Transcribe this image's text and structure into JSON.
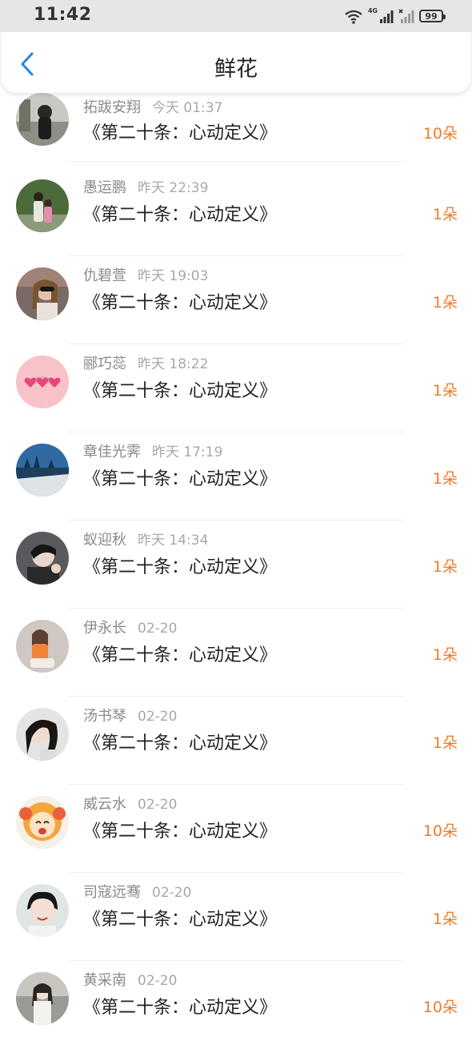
{
  "status_bar": {
    "time": "11:42",
    "battery": "99",
    "network": "4G",
    "icons": [
      "wifi-icon",
      "signal-icon",
      "signal-no-service-icon",
      "battery-icon"
    ]
  },
  "header": {
    "title": "鲜花",
    "back_icon": "chevron-left-icon",
    "accent": "#1e88e5"
  },
  "colors": {
    "count": "#f07b2a",
    "name": "#8a8a8a",
    "title": "#222222"
  },
  "items": [
    {
      "name": "拓跋安翔",
      "time": "今天 01:37",
      "title": "《第二十条：心动定义》",
      "count": "10朵"
    },
    {
      "name": "愚运鹏",
      "time": "昨天 22:39",
      "title": "《第二十条：心动定义》",
      "count": "1朵"
    },
    {
      "name": "仇碧萱",
      "time": "昨天 19:03",
      "title": "《第二十条：心动定义》",
      "count": "1朵"
    },
    {
      "name": "郦巧蕊",
      "time": "昨天 18:22",
      "title": "《第二十条：心动定义》",
      "count": "1朵"
    },
    {
      "name": "章佳光霁",
      "time": "昨天 17:19",
      "title": "《第二十条：心动定义》",
      "count": "1朵"
    },
    {
      "name": "蚁迎秋",
      "time": "昨天 14:34",
      "title": "《第二十条：心动定义》",
      "count": "1朵"
    },
    {
      "name": "伊永长",
      "time": "02-20",
      "title": "《第二十条：心动定义》",
      "count": "1朵"
    },
    {
      "name": "汤书琴",
      "time": "02-20",
      "title": "《第二十条：心动定义》",
      "count": "1朵"
    },
    {
      "name": "威云水",
      "time": "02-20",
      "title": "《第二十条：心动定义》",
      "count": "10朵"
    },
    {
      "name": "司寇远骞",
      "time": "02-20",
      "title": "《第二十条：心动定义》",
      "count": "1朵"
    },
    {
      "name": "黄采南",
      "time": "02-20",
      "title": "《第二十条：心动定义》",
      "count": "10朵"
    }
  ]
}
